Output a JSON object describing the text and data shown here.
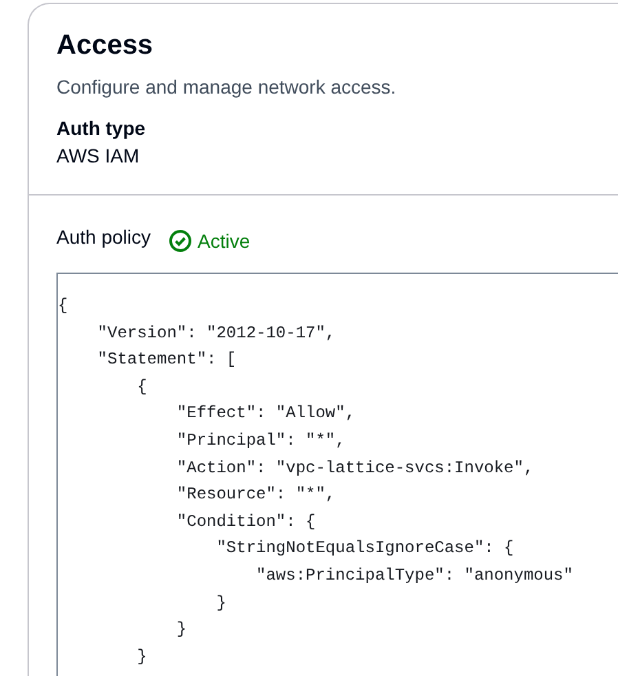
{
  "panel": {
    "title": "Access",
    "description": "Configure and manage network access.",
    "fields": [
      {
        "label": "Auth type",
        "value": "AWS IAM"
      }
    ],
    "policy": {
      "label": "Auth policy",
      "status": {
        "kind": "success",
        "label": "Active"
      },
      "code_lines": [
        "{",
        "    \"Version\": \"2012-10-17\",",
        "    \"Statement\": [",
        "        {",
        "            \"Effect\": \"Allow\",",
        "            \"Principal\": \"*\",",
        "            \"Action\": \"vpc-lattice-svcs:Invoke\",",
        "            \"Resource\": \"*\",",
        "            \"Condition\": {",
        "                \"StringNotEqualsIgnoreCase\": {",
        "                    \"aws:PrincipalType\": \"anonymous\"",
        "                }",
        "            }",
        "        }"
      ]
    }
  }
}
